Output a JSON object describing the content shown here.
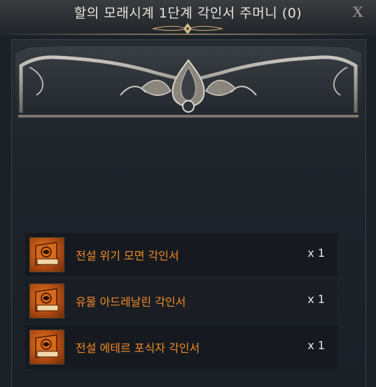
{
  "window": {
    "title": "할의 모래시계 1단계 각인서 주머니 (0)",
    "close_label": "X"
  },
  "items": [
    {
      "name": "전설 위기 모면 각인서",
      "quantity": "x 1",
      "icon": "engraving-book-icon"
    },
    {
      "name": "유물 아드레날린 각인서",
      "quantity": "x 1",
      "icon": "engraving-book-icon"
    },
    {
      "name": "전설 에테르 포식자 각인서",
      "quantity": "x 1",
      "icon": "engraving-book-icon"
    }
  ],
  "colors": {
    "item_name": "#f08a24",
    "quantity": "#e6e6e6",
    "title": "#e8e4dc",
    "background": "#1c2128"
  }
}
